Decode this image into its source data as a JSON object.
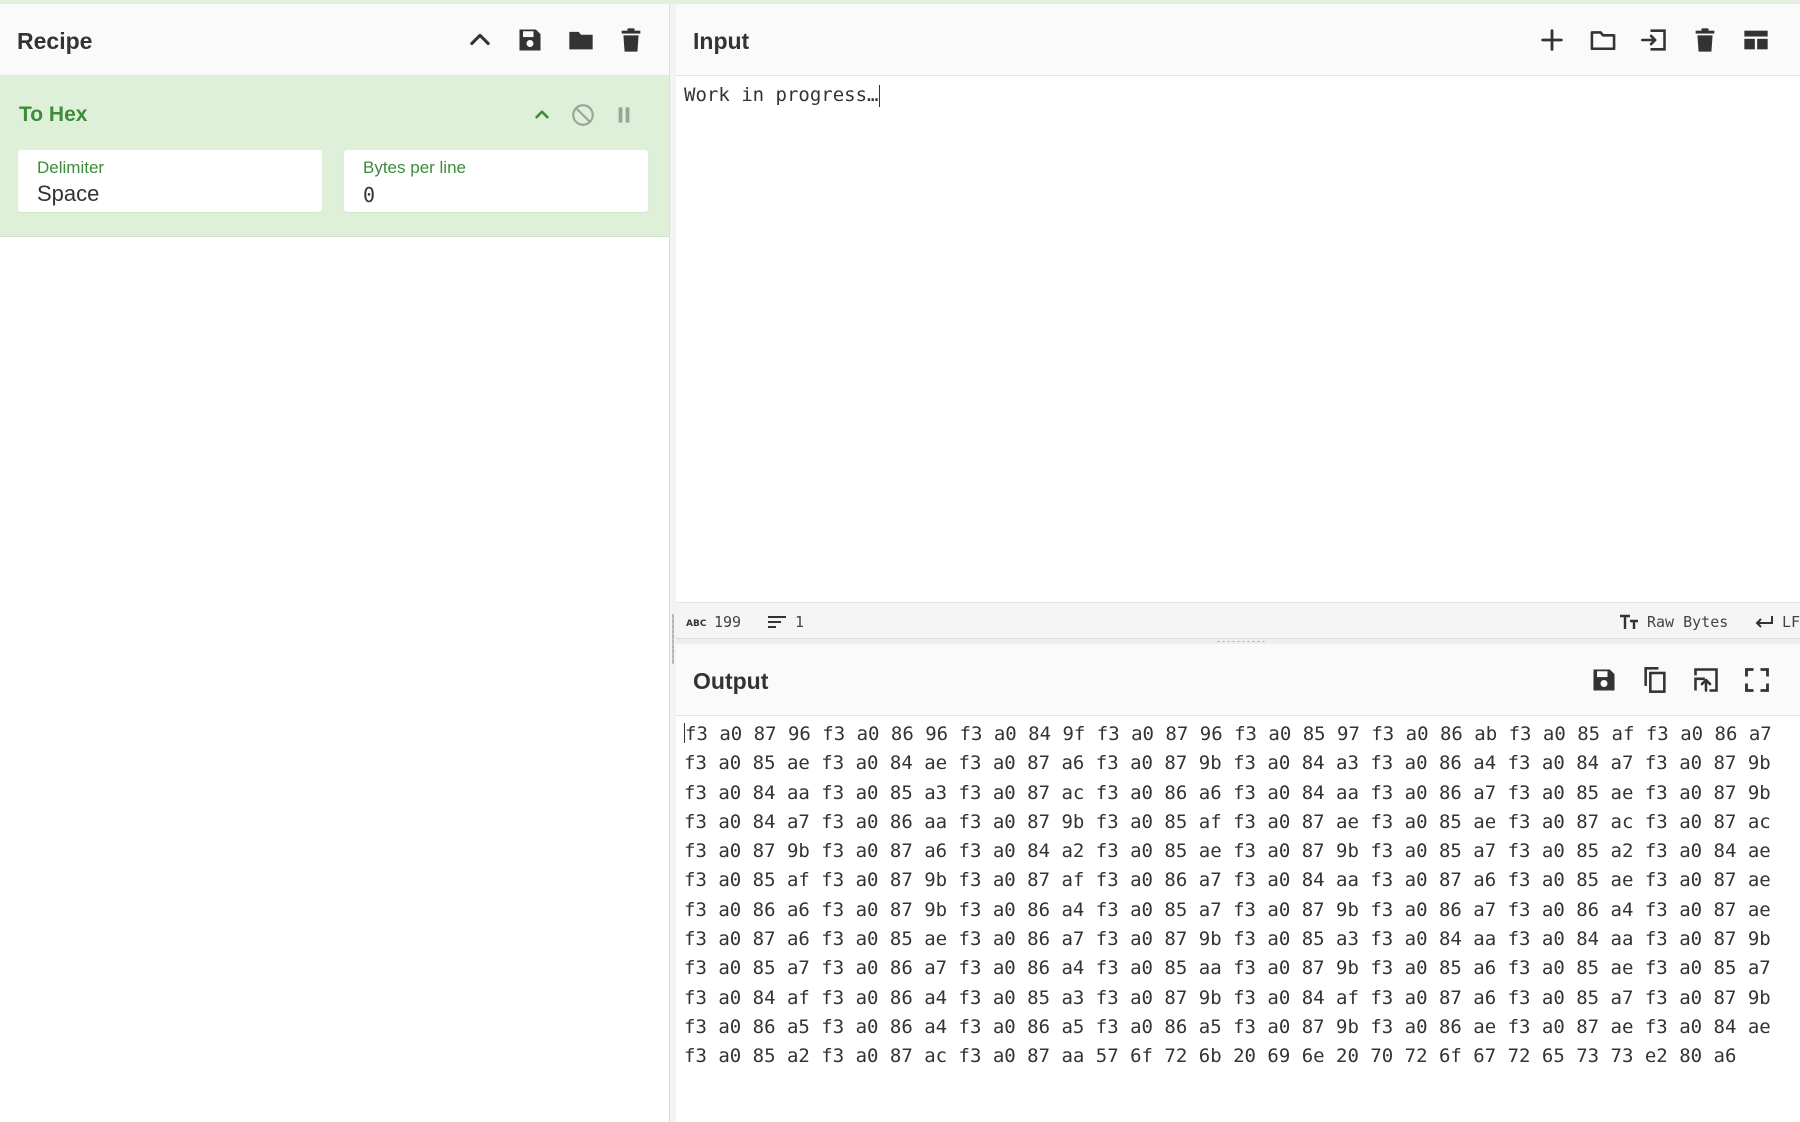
{
  "recipe": {
    "title": "Recipe",
    "tools": [
      "collapse-icon",
      "save-icon",
      "folder-icon",
      "trash-icon"
    ],
    "operation": {
      "name": "To Hex",
      "args": [
        {
          "label": "Delimiter",
          "value": "Space"
        },
        {
          "label": "Bytes per line",
          "value": "0"
        }
      ]
    }
  },
  "input": {
    "title": "Input",
    "text": "Work in progress…",
    "status": {
      "length": "199",
      "lines": "1",
      "encoding": "Raw Bytes",
      "eol": "LF"
    }
  },
  "output": {
    "title": "Output",
    "lines": [
      "f3 a0 87 96 f3 a0 86 96 f3 a0 84 9f f3 a0 87 96 f3 a0 85 97 f3 a0 86 ab f3 a0 85 af f3 a0 86 a7",
      "f3 a0 85 ae f3 a0 84 ae f3 a0 87 a6 f3 a0 87 9b f3 a0 84 a3 f3 a0 86 a4 f3 a0 84 a7 f3 a0 87 9b",
      "f3 a0 84 aa f3 a0 85 a3 f3 a0 87 ac f3 a0 86 a6 f3 a0 84 aa f3 a0 86 a7 f3 a0 85 ae f3 a0 87 9b",
      "f3 a0 84 a7 f3 a0 86 aa f3 a0 87 9b f3 a0 85 af f3 a0 87 ae f3 a0 85 ae f3 a0 87 ac f3 a0 87 ac",
      "f3 a0 87 9b f3 a0 87 a6 f3 a0 84 a2 f3 a0 85 ae f3 a0 87 9b f3 a0 85 a7 f3 a0 85 a2 f3 a0 84 ae",
      "f3 a0 85 af f3 a0 87 9b f3 a0 87 af f3 a0 86 a7 f3 a0 84 aa f3 a0 87 a6 f3 a0 85 ae f3 a0 87 ae",
      "f3 a0 86 a6 f3 a0 87 9b f3 a0 86 a4 f3 a0 85 a7 f3 a0 87 9b f3 a0 86 a7 f3 a0 86 a4 f3 a0 87 ae",
      "f3 a0 87 a6 f3 a0 85 ae f3 a0 86 a7 f3 a0 87 9b f3 a0 85 a3 f3 a0 84 aa f3 a0 84 aa f3 a0 87 9b",
      "f3 a0 85 a7 f3 a0 86 a7 f3 a0 86 a4 f3 a0 85 aa f3 a0 87 9b f3 a0 85 a6 f3 a0 85 ae f3 a0 85 a7",
      "f3 a0 84 af f3 a0 86 a4 f3 a0 85 a3 f3 a0 87 9b f3 a0 84 af f3 a0 87 a6 f3 a0 85 a7 f3 a0 87 9b",
      "f3 a0 86 a5 f3 a0 86 a4 f3 a0 86 a5 f3 a0 86 a5 f3 a0 87 9b f3 a0 86 ae f3 a0 87 ae f3 a0 84 ae",
      "f3 a0 85 a2 f3 a0 87 ac f3 a0 87 aa 57 6f 72 6b 20 69 6e 20 70 72 6f 67 72 65 73 73 e2 80 a6"
    ]
  },
  "colors": {
    "accent_green": "#3c8c3c",
    "operation_bg": "#dff0d8"
  }
}
